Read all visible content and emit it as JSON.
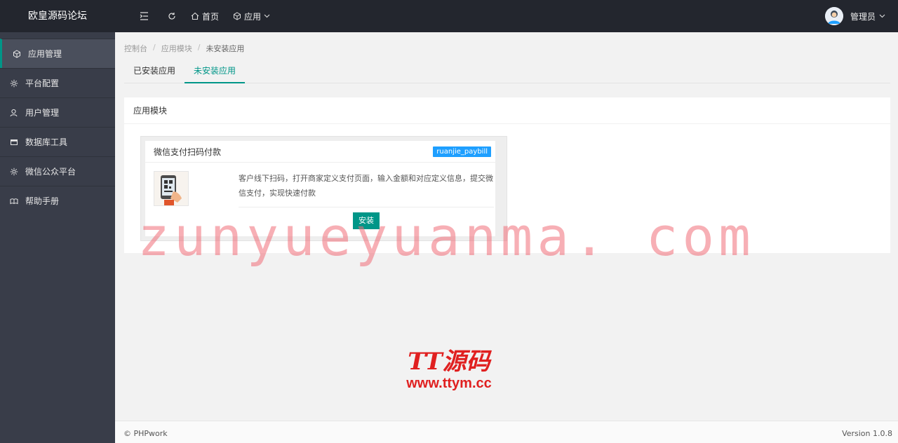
{
  "topbar": {
    "logo": "欧皇源码论坛",
    "home_label": "首页",
    "apps_label": "应用",
    "user_name": "管理员",
    "icons": [
      "menu-fold-icon",
      "refresh-icon",
      "home-icon",
      "cube-icon",
      "avatar"
    ]
  },
  "sidebar": {
    "items": [
      {
        "label": "应用管理",
        "icon": "cube-icon",
        "active": true
      },
      {
        "label": "平台配置",
        "icon": "gear-icon"
      },
      {
        "label": "用户管理",
        "icon": "user-icon"
      },
      {
        "label": "数据库工具",
        "icon": "database-icon"
      },
      {
        "label": "微信公众平台",
        "icon": "gear-icon"
      },
      {
        "label": "帮助手册",
        "icon": "book-icon"
      }
    ]
  },
  "breadcrumb": {
    "items": [
      "控制台",
      "应用模块",
      "未安装应用"
    ],
    "separator": "/"
  },
  "tabs": [
    {
      "label": "已安装应用",
      "active": false
    },
    {
      "label": "未安装应用",
      "active": true
    }
  ],
  "panel": {
    "title": "应用模块",
    "module": {
      "name": "微信支付扫码付款",
      "tag": "ruanjie_paybill",
      "description": "客户线下扫码，打开商家定义支付页面，输入金额和对应定义信息，提交微信支付，实现快速付款",
      "install_label": "安装"
    }
  },
  "footer": {
    "copyright": "© PHPwork",
    "version": "Version 1.0.8"
  },
  "watermarks": {
    "main": "zunyueyuanma. com",
    "logo_title": "TT源码",
    "logo_url": "www.ttym.cc"
  },
  "colors": {
    "topbar_bg": "#23262e",
    "sidebar_bg": "#393d49",
    "accent": "#009688",
    "tag_bg": "#1e9fff",
    "watermark": "#f06e78",
    "logo_red": "#e02020"
  }
}
